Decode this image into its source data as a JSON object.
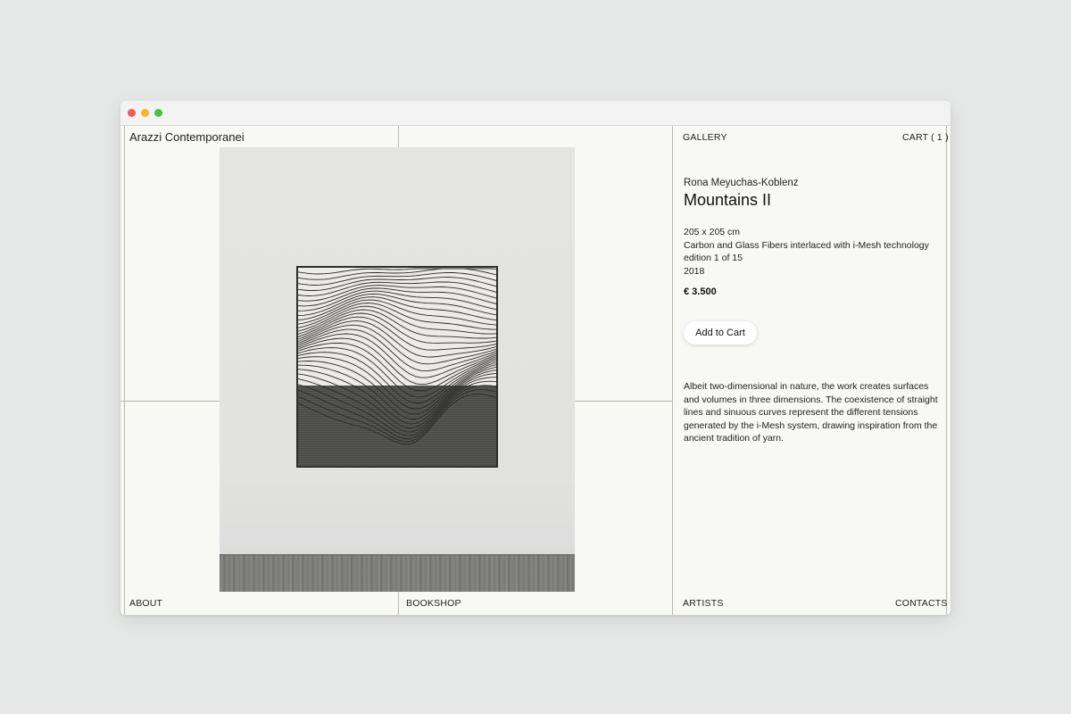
{
  "site": {
    "brand": "Arazzi Contemporanei",
    "nav": {
      "gallery": "GALLERY",
      "cart": "CART ( 1 )",
      "about": "ABOUT",
      "bookshop": "BOOKSHOP",
      "artists": "ARTISTS",
      "contacts": "CONTACTS"
    }
  },
  "product": {
    "artist": "Rona Meyuchas-Koblenz",
    "title": "Mountains II",
    "dimensions": "205 x 205 cm",
    "material": "Carbon and Glass Fibers interlaced with i-Mesh technology",
    "edition": "edition 1 of 15",
    "year": "2018",
    "price": "€ 3.500",
    "add_to_cart": "Add to Cart",
    "description": "Albeit two-dimensional in nature, the work creates surfaces and volumes in three dimensions. The coexistence of straight lines and sinuous curves represent the different tensions generated by the i-Mesh system, drawing inspiration from the ancient tradition of yarn."
  },
  "colors": {
    "page_bg": "#e6e7e7",
    "site_bg": "#f8f8f4",
    "rule": "#b9b9b0",
    "close": "#ef5b55",
    "minimize": "#f5b62b",
    "maximize": "#4bbf46"
  }
}
